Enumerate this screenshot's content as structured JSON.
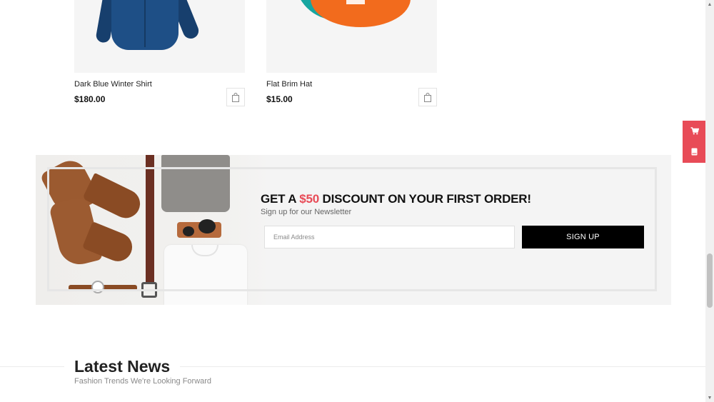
{
  "products": [
    {
      "name": "Dark Blue Winter Shirt",
      "price": "$180.00",
      "image": "blue-shirt",
      "cart_icon": "shopping-bag-icon"
    },
    {
      "name": "Flat Brim Hat",
      "price": "$15.00",
      "image": "flat-brim-hat",
      "cart_icon": "shopping-bag-icon"
    }
  ],
  "side_widget": {
    "cart_icon": "cart-icon",
    "book_icon": "book-icon",
    "color": "#e84b57"
  },
  "newsletter": {
    "headline_prefix": "GET A ",
    "headline_amount": "$50",
    "headline_suffix": " DISCOUNT ON YOUR FIRST ORDER!",
    "subheadline": "Sign up for our Newsletter",
    "email_placeholder": "Email Address",
    "signup_label": "SIGN UP",
    "accent_color": "#e84b57"
  },
  "latest_news": {
    "title": "Latest News",
    "subtitle": "Fashion Trends We're Looking Forward"
  }
}
